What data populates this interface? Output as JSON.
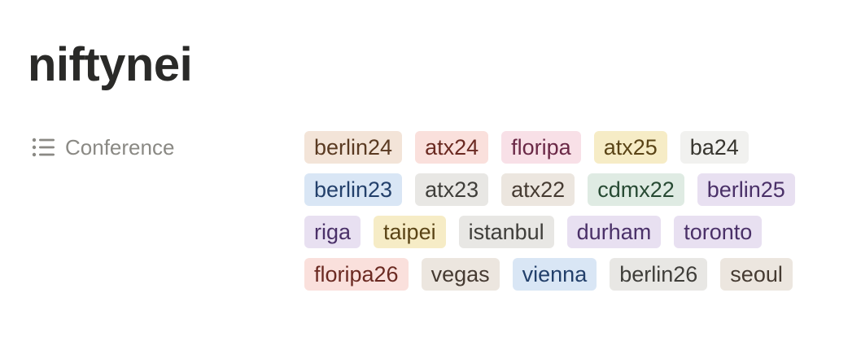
{
  "page": {
    "title": "niftynei"
  },
  "property": {
    "icon": "multi-select-list-icon",
    "label": "Conference"
  },
  "tags": [
    {
      "label": "berlin24",
      "color": "brown"
    },
    {
      "label": "atx24",
      "color": "red"
    },
    {
      "label": "floripa",
      "color": "pink"
    },
    {
      "label": "atx25",
      "color": "yellow"
    },
    {
      "label": "ba24",
      "color": "default"
    },
    {
      "label": "berlin23",
      "color": "blue"
    },
    {
      "label": "atx23",
      "color": "gray"
    },
    {
      "label": "atx22",
      "color": "sand"
    },
    {
      "label": "cdmx22",
      "color": "green"
    },
    {
      "label": "berlin25",
      "color": "purple"
    },
    {
      "label": "riga",
      "color": "purple"
    },
    {
      "label": "taipei",
      "color": "yellow"
    },
    {
      "label": "istanbul",
      "color": "gray"
    },
    {
      "label": "durham",
      "color": "purple"
    },
    {
      "label": "toronto",
      "color": "purple"
    },
    {
      "label": "floripa26",
      "color": "red"
    },
    {
      "label": "vegas",
      "color": "sand"
    },
    {
      "label": "vienna",
      "color": "blue"
    },
    {
      "label": "berlin26",
      "color": "gray"
    },
    {
      "label": "seoul",
      "color": "sand"
    }
  ]
}
